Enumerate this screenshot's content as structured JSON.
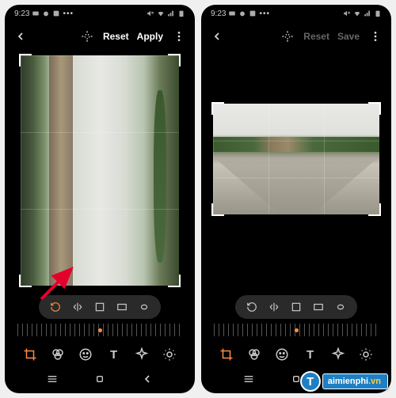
{
  "status": {
    "time": "9:23"
  },
  "left": {
    "topbar": {
      "reset": "Reset",
      "apply": "Apply"
    }
  },
  "right": {
    "topbar": {
      "reset": "Reset",
      "save": "Save"
    }
  },
  "watermark": {
    "letter": "T",
    "brand": "aimienphi",
    "suffix": ".vn"
  },
  "tool_icons": [
    "rotate",
    "flip-horizontal",
    "aspect-free",
    "aspect-ratio",
    "cloud-skew"
  ],
  "bottom_icons": [
    "crop",
    "filters",
    "sticker",
    "text",
    "draw",
    "brightness"
  ],
  "colors": {
    "accent": "#ff8c42",
    "brand": "#1e7fc4"
  }
}
